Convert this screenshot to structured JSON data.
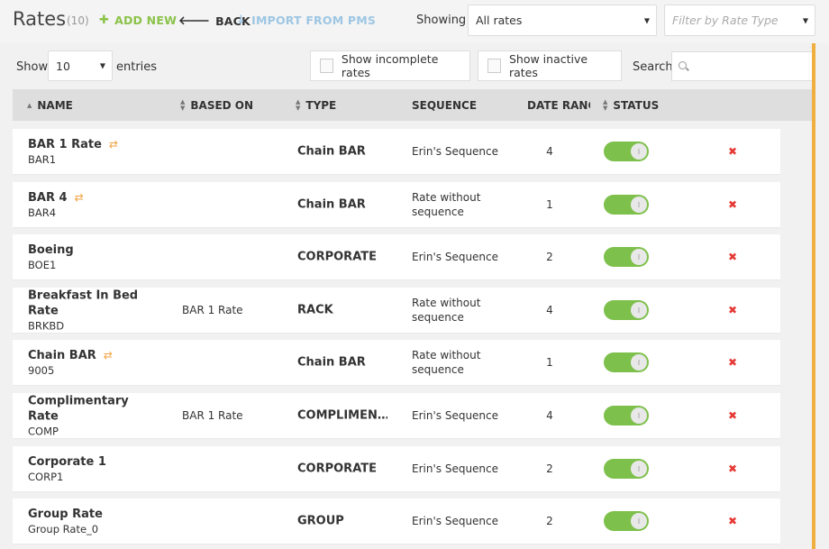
{
  "header": {
    "title": "Rates",
    "count": "(10)",
    "add_new": "ADD NEW",
    "back": "BACK",
    "import": "IMPORT FROM PMS",
    "showing_label": "Showing",
    "showing_value": "All rates",
    "filter_placeholder": "Filter by Rate Type"
  },
  "controls": {
    "show_label": "Show",
    "entries_value": "10",
    "entries_label": "entries",
    "show_incomplete": "Show incomplete rates",
    "show_inactive": "Show inactive rates",
    "search_label": "Search",
    "search_value": ""
  },
  "table": {
    "columns": {
      "name": "NAME",
      "based_on": "BASED ON",
      "type": "TYPE",
      "sequence": "SEQUENCE",
      "date_range": "DATE RANGE",
      "status": "STATUS"
    },
    "rows": [
      {
        "name": "BAR 1 Rate",
        "code": "BAR1",
        "based_on": "",
        "type": "Chain BAR",
        "sequence": "Erin's Sequence",
        "date_range": "4",
        "linked": true,
        "active": true
      },
      {
        "name": "BAR 4",
        "code": "BAR4",
        "based_on": "",
        "type": "Chain BAR",
        "sequence": "Rate without sequence",
        "date_range": "1",
        "linked": true,
        "active": true
      },
      {
        "name": "Boeing",
        "code": "BOE1",
        "based_on": "",
        "type": "CORPORATE",
        "sequence": "Erin's Sequence",
        "date_range": "2",
        "linked": false,
        "active": true
      },
      {
        "name": "Breakfast In Bed Rate",
        "code": "BRKBD",
        "based_on": "BAR 1 Rate",
        "type": "RACK",
        "sequence": "Rate without sequence",
        "date_range": "4",
        "linked": false,
        "active": true
      },
      {
        "name": "Chain BAR",
        "code": "9005",
        "based_on": "",
        "type": "Chain BAR",
        "sequence": "Rate without sequence",
        "date_range": "1",
        "linked": true,
        "active": true
      },
      {
        "name": "Complimentary Rate",
        "code": "COMP",
        "based_on": "BAR 1 Rate",
        "type": "COMPLIMEN…",
        "sequence": "Erin's Sequence",
        "date_range": "4",
        "linked": false,
        "active": true
      },
      {
        "name": "Corporate 1",
        "code": "CORP1",
        "based_on": "",
        "type": "CORPORATE",
        "sequence": "Erin's Sequence",
        "date_range": "2",
        "linked": false,
        "active": true
      },
      {
        "name": "Group Rate",
        "code": "Group Rate_0",
        "based_on": "",
        "type": "GROUP",
        "sequence": "Erin's Sequence",
        "date_range": "2",
        "linked": false,
        "active": true
      }
    ]
  },
  "icons": {
    "add": "plus-icon",
    "back": "arrow-left-icon",
    "import": "arrow-down-icon",
    "linked": "swap-icon",
    "delete": "close-icon",
    "search": "search-icon"
  },
  "colors": {
    "add": "#8bc34a",
    "import": "#9dc6e3",
    "toggle_on": "#7dc04b",
    "delete": "#e53935",
    "linked_icon": "#f0a240",
    "scroll_accent": "#f0b040"
  }
}
